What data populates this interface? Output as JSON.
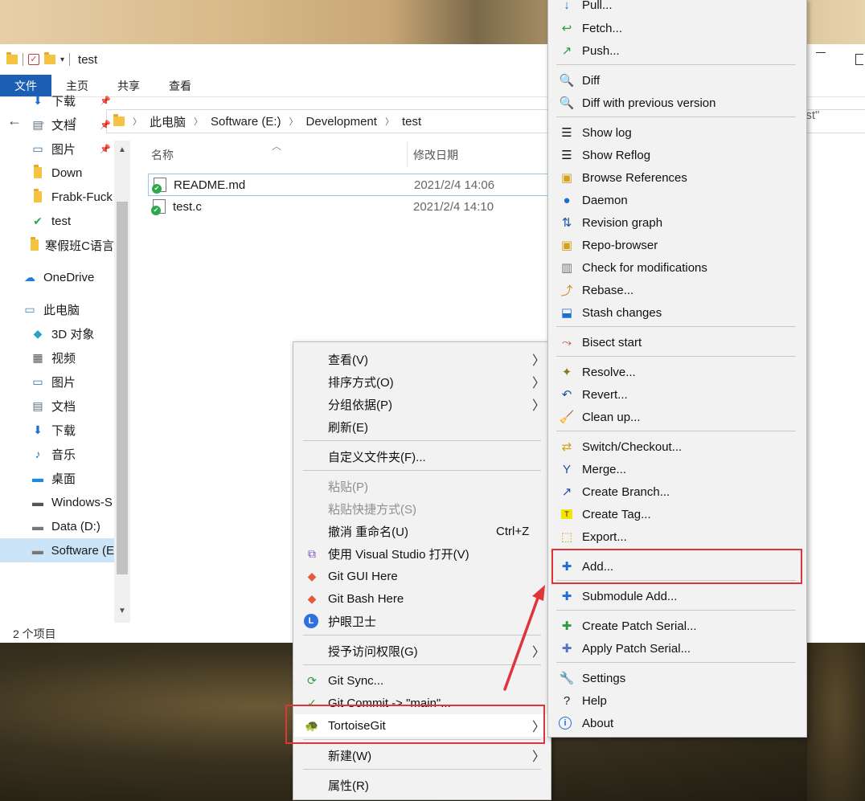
{
  "window": {
    "title": "test"
  },
  "ribbon": {
    "tabs": [
      "文件",
      "主页",
      "共享",
      "查看"
    ]
  },
  "address": {
    "crumbs": [
      "此电脑",
      "Software (E:)",
      "Development",
      "test"
    ],
    "search_remnant": "est\""
  },
  "nav": {
    "items": [
      {
        "label": "下载",
        "icon": "download-arrow-icon",
        "pinned": true
      },
      {
        "label": "文档",
        "icon": "document-icon",
        "pinned": true
      },
      {
        "label": "图片",
        "icon": "picture-icon",
        "pinned": true
      },
      {
        "label": "Down",
        "icon": "folder-icon",
        "pinned": false
      },
      {
        "label": "Frabk-Fuck",
        "icon": "folder-icon",
        "pinned": false
      },
      {
        "label": "test",
        "icon": "git-folder-icon",
        "pinned": false
      },
      {
        "label": "寒假班C语言",
        "icon": "folder-icon",
        "pinned": false
      },
      {
        "label": "OneDrive",
        "icon": "cloud-icon",
        "pinned": false
      },
      {
        "label": "此电脑",
        "icon": "computer-icon",
        "pinned": false
      },
      {
        "label": "3D 对象",
        "icon": "cube-icon",
        "pinned": false
      },
      {
        "label": "视频",
        "icon": "film-icon",
        "pinned": false
      },
      {
        "label": "图片",
        "icon": "picture-icon",
        "pinned": false
      },
      {
        "label": "文档",
        "icon": "document-icon",
        "pinned": false
      },
      {
        "label": "下载",
        "icon": "download-arrow-icon",
        "pinned": false
      },
      {
        "label": "音乐",
        "icon": "music-note-icon",
        "pinned": false
      },
      {
        "label": "桌面",
        "icon": "desktop-icon",
        "pinned": false
      },
      {
        "label": "Windows-S",
        "icon": "windows-drive-icon",
        "pinned": false
      },
      {
        "label": "Data (D:)",
        "icon": "drive-icon",
        "pinned": false
      },
      {
        "label": "Software (E",
        "icon": "drive-icon",
        "pinned": false
      }
    ]
  },
  "status": {
    "items_count": "2 个项目"
  },
  "filelist": {
    "col_name": "名称",
    "col_date": "修改日期",
    "files": [
      {
        "name": "README.md",
        "date": "2021/2/4 14:06"
      },
      {
        "name": "test.c",
        "date": "2021/2/4 14:10"
      }
    ]
  },
  "context_menu": {
    "items": [
      {
        "label": "查看(V)",
        "submenu": true
      },
      {
        "label": "排序方式(O)",
        "submenu": true
      },
      {
        "label": "分组依据(P)",
        "submenu": true
      },
      {
        "label": "刷新(E)"
      },
      {
        "label": "自定义文件夹(F)..."
      },
      {
        "label": "粘贴(P)",
        "disabled": true
      },
      {
        "label": "粘贴快捷方式(S)",
        "disabled": true
      },
      {
        "label": "撤消 重命名(U)",
        "shortcut": "Ctrl+Z"
      },
      {
        "label": "使用 Visual Studio 打开(V)",
        "icon": "visual-studio-icon"
      },
      {
        "label": "Git GUI Here",
        "icon": "git-gui-icon"
      },
      {
        "label": "Git Bash Here",
        "icon": "git-bash-icon"
      },
      {
        "label": "护眼卫士",
        "icon": "eye-guard-icon"
      },
      {
        "label": "授予访问权限(G)",
        "submenu": true
      },
      {
        "label": "Git Sync...",
        "icon": "git-sync-icon"
      },
      {
        "label": "Git Commit -> \"main\"...",
        "icon": "git-commit-icon"
      },
      {
        "label": "TortoiseGit",
        "icon": "tortoisegit-icon",
        "submenu": true
      },
      {
        "label": "新建(W)",
        "submenu": true
      },
      {
        "label": "属性(R)"
      }
    ]
  },
  "tortoise_menu": {
    "items": [
      {
        "label": "Pull...",
        "icon": "pull-icon"
      },
      {
        "label": "Fetch...",
        "icon": "fetch-icon"
      },
      {
        "label": "Push...",
        "icon": "push-icon"
      },
      {
        "label": "Diff",
        "icon": "diff-magnifier-icon"
      },
      {
        "label": "Diff with previous version",
        "icon": "diff-magnifier-icon"
      },
      {
        "label": "Show log",
        "icon": "log-lines-icon"
      },
      {
        "label": "Show Reflog",
        "icon": "log-lines-icon"
      },
      {
        "label": "Browse References",
        "icon": "references-icon"
      },
      {
        "label": "Daemon",
        "icon": "globe-icon"
      },
      {
        "label": "Revision graph",
        "icon": "revision-graph-icon"
      },
      {
        "label": "Repo-browser",
        "icon": "repo-browser-icon"
      },
      {
        "label": "Check for modifications",
        "icon": "check-modifications-icon"
      },
      {
        "label": "Rebase...",
        "icon": "rebase-icon"
      },
      {
        "label": "Stash changes",
        "icon": "stash-icon"
      },
      {
        "label": "Bisect start",
        "icon": "bisect-icon"
      },
      {
        "label": "Resolve...",
        "icon": "resolve-icon"
      },
      {
        "label": "Revert...",
        "icon": "revert-icon"
      },
      {
        "label": "Clean up...",
        "icon": "broom-icon"
      },
      {
        "label": "Switch/Checkout...",
        "icon": "switch-icon"
      },
      {
        "label": "Merge...",
        "icon": "merge-icon"
      },
      {
        "label": "Create Branch...",
        "icon": "branch-icon"
      },
      {
        "label": "Create Tag...",
        "icon": "tag-icon"
      },
      {
        "label": "Export...",
        "icon": "export-icon"
      },
      {
        "label": "Add...",
        "icon": "plus-icon"
      },
      {
        "label": "Submodule Add...",
        "icon": "plus-icon"
      },
      {
        "label": "Create Patch Serial...",
        "icon": "patch-icon"
      },
      {
        "label": "Apply Patch Serial...",
        "icon": "apply-patch-icon"
      },
      {
        "label": "Settings",
        "icon": "wrench-icon"
      },
      {
        "label": "Help",
        "icon": "question-icon"
      },
      {
        "label": "About",
        "icon": "info-icon"
      }
    ]
  },
  "colors": {
    "file_tab": "#1a5fb4",
    "annotation_red": "#e0343b",
    "selection": "#cce4f7"
  }
}
